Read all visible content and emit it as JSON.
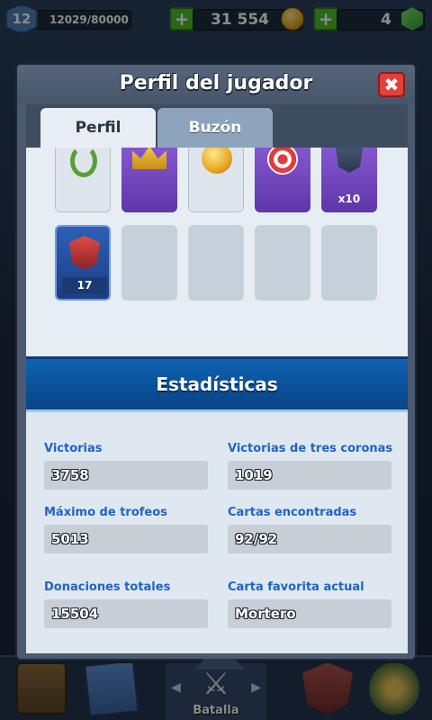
{
  "topbar": {
    "level": "12",
    "xp": "12029/80000",
    "plus_label": "+",
    "gold": "31 554",
    "gems": "4"
  },
  "modal": {
    "title": "Perfil del jugador",
    "close_label": "✖",
    "tabs": [
      {
        "label": "Perfil",
        "active": true
      },
      {
        "label": "Buzón",
        "active": false
      }
    ],
    "badges": {
      "swords_count": "x10",
      "shield_level": "17"
    },
    "stats_title": "Estadísticas",
    "stats": [
      {
        "label": "Victorias",
        "value": "3758"
      },
      {
        "label": "Victorias de tres coronas",
        "value": "1019"
      },
      {
        "label": "Máximo de trofeos",
        "value": "5013"
      },
      {
        "label": "Cartas encontradas",
        "value": "92/92"
      },
      {
        "label": "Donaciones totales",
        "value": "15504"
      },
      {
        "label": "Carta favorita actual",
        "value": "Mortero"
      }
    ]
  },
  "bottombar": {
    "battle_label": "Batalla",
    "left_arrow": "◀",
    "right_arrow": "▶"
  },
  "colors": {
    "accent_blue": "#1f63c9",
    "stats_header": "#0a4f97",
    "close_red": "#e0413a",
    "plus_green": "#4cbd2b"
  }
}
